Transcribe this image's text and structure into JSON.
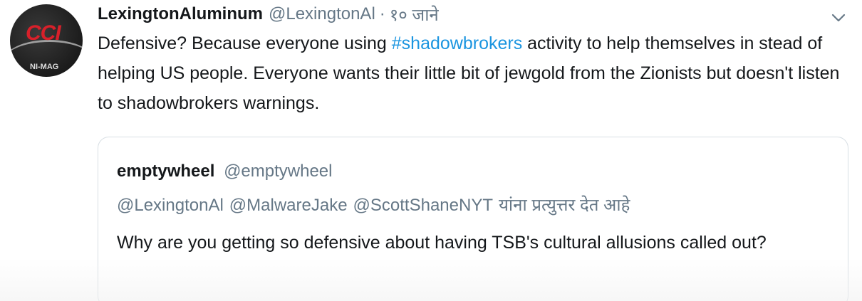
{
  "tweet": {
    "display_name": "LexingtonAluminum",
    "handle": "@LexingtonAl",
    "separator": "·",
    "time": "१० जाने",
    "text_before": "Defensive? Because everyone using ",
    "hashtag": "#shadowbrokers",
    "text_after": " activity to help themselves in stead of helping US people. Everyone wants their little bit of jewgold from the Zionists but doesn't listen to shadowbrokers warnings.",
    "avatar": {
      "logo_text": "CCI",
      "sub_text": "NI-MAG",
      "logo_color": "#d8202a"
    },
    "menu_icon": "chevron-down-icon"
  },
  "quoted_tweet": {
    "display_name": "emptywheel",
    "handle": "@emptywheel",
    "reply_mentions": [
      "@LexingtonAl",
      "@MalwareJake",
      "@ScottShaneNYT"
    ],
    "reply_suffix": "यांना प्रत्युत्तर देत आहे",
    "text": "Why are you getting so defensive about having TSB's cultural allusions called out?"
  },
  "colors": {
    "text": "#14171a",
    "secondary": "#657786",
    "link": "#1b95e0",
    "border": "#d8dfe4"
  }
}
